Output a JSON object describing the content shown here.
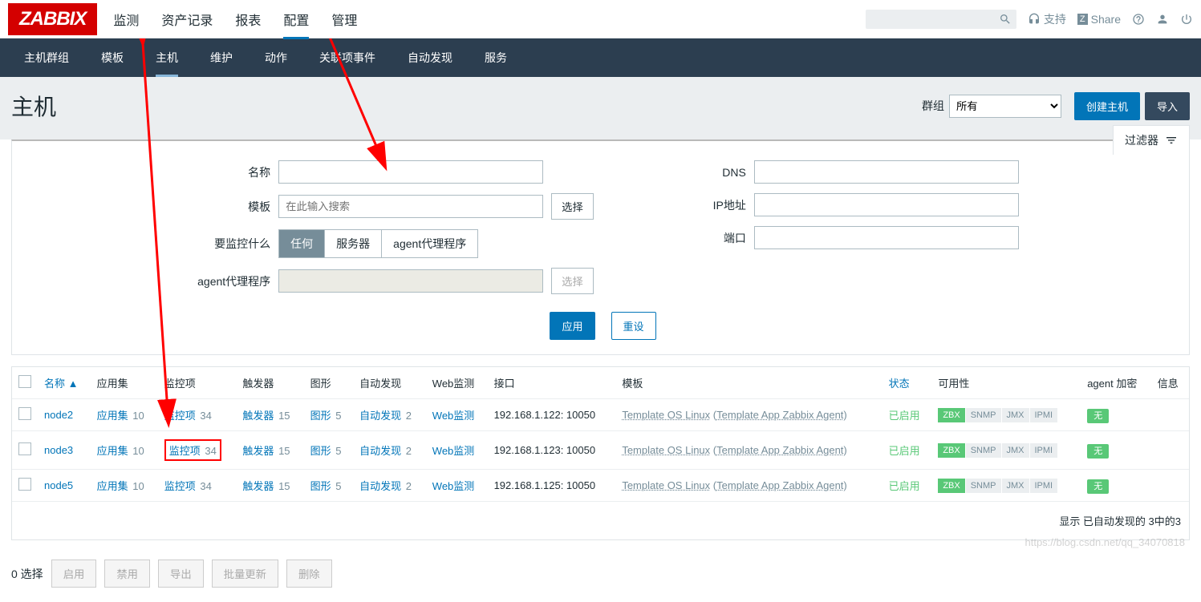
{
  "topnav": {
    "logo": "ZABBIX",
    "items": [
      "监测",
      "资产记录",
      "报表",
      "配置",
      "管理"
    ],
    "support": "支持",
    "share": "Share"
  },
  "subnav": {
    "items": [
      "主机群组",
      "模板",
      "主机",
      "维护",
      "动作",
      "关联项事件",
      "自动发现",
      "服务"
    ],
    "active_index": 2
  },
  "page": {
    "title": "主机",
    "group_label": "群组",
    "group_value": "所有",
    "create_btn": "创建主机",
    "import_btn": "导入"
  },
  "filter": {
    "tab_label": "过滤器",
    "name_label": "名称",
    "template_label": "模板",
    "template_placeholder": "在此输入搜索",
    "template_select_btn": "选择",
    "monitor_label": "要监控什么",
    "monitor_options": [
      "任何",
      "服务器",
      "agent代理程序"
    ],
    "proxy_label": "agent代理程序",
    "proxy_select_btn": "选择",
    "dns_label": "DNS",
    "ip_label": "IP地址",
    "port_label": "端口",
    "apply_btn": "应用",
    "reset_btn": "重设"
  },
  "table": {
    "headers": {
      "name": "名称",
      "apps": "应用集",
      "items": "监控项",
      "triggers": "触发器",
      "graphs": "图形",
      "discovery": "自动发现",
      "web": "Web监测",
      "interface": "接口",
      "templates": "模板",
      "status": "状态",
      "availability": "可用性",
      "agent_enc": "agent 加密",
      "info": "信息"
    },
    "sort_indicator": "▲",
    "rows": [
      {
        "name": "node2",
        "apps": "10",
        "items": "34",
        "triggers": "15",
        "graphs": "5",
        "discovery": "2",
        "web": "Web监测",
        "iface": "192.168.1.122: 10050",
        "tmpl1": "Template OS Linux",
        "tmpl2": "Template App Zabbix Agent",
        "status": "已启用",
        "zbx": "ZBX",
        "snmp": "SNMP",
        "jmx": "JMX",
        "ipmi": "IPMI",
        "enc": "无"
      },
      {
        "name": "node3",
        "apps": "10",
        "items": "34",
        "triggers": "15",
        "graphs": "5",
        "discovery": "2",
        "web": "Web监测",
        "iface": "192.168.1.123: 10050",
        "tmpl1": "Template OS Linux",
        "tmpl2": "Template App Zabbix Agent",
        "status": "已启用",
        "zbx": "ZBX",
        "snmp": "SNMP",
        "jmx": "JMX",
        "ipmi": "IPMI",
        "enc": "无"
      },
      {
        "name": "node5",
        "apps": "10",
        "items": "34",
        "triggers": "15",
        "graphs": "5",
        "discovery": "2",
        "web": "Web监测",
        "iface": "192.168.1.125: 10050",
        "tmpl1": "Template OS Linux",
        "tmpl2": "Template App Zabbix Agent",
        "status": "已启用",
        "zbx": "ZBX",
        "snmp": "SNMP",
        "jmx": "JMX",
        "ipmi": "IPMI",
        "enc": "无"
      }
    ],
    "link_labels": {
      "apps": "应用集",
      "items": "监控项",
      "triggers": "触发器",
      "graphs": "图形",
      "discovery": "自动发现"
    },
    "footer": "显示 已自动发现的 3中的3"
  },
  "actions": {
    "selected": "0 选择",
    "enable": "启用",
    "disable": "禁用",
    "export": "导出",
    "massupdate": "批量更新",
    "delete": "删除"
  },
  "watermark": "https://blog.csdn.net/qq_34070818"
}
